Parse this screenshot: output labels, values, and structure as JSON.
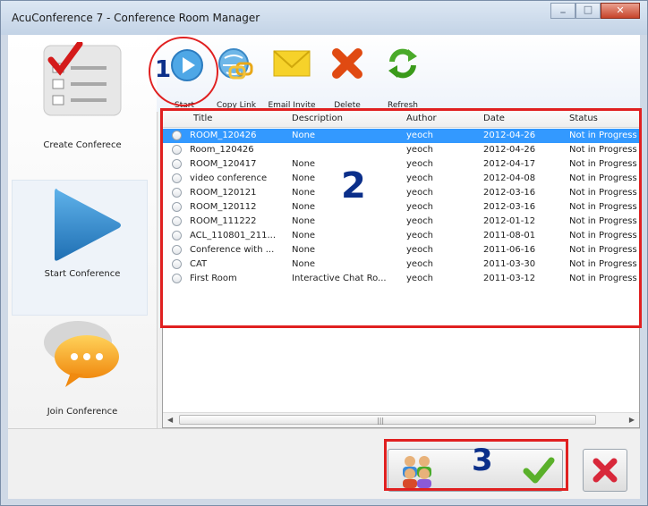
{
  "window": {
    "title": "AcuConference 7 - Conference Room Manager"
  },
  "sidebar": {
    "items": [
      {
        "label": "Create Conferece",
        "icon": "checklist-icon"
      },
      {
        "label": "Start Conference",
        "icon": "play-arrow-icon",
        "selected": true
      },
      {
        "label": "Join Conference",
        "icon": "chat-bubble-icon"
      }
    ]
  },
  "toolbar": {
    "start_label": "Start",
    "copy_label": "Copy Link",
    "email_label": "Email Invite",
    "delete_label": "Delete",
    "refresh_label": "Refresh"
  },
  "table": {
    "columns": [
      "Title",
      "Description",
      "Author",
      "Date",
      "Status"
    ],
    "rows": [
      {
        "title": "ROOM_120426",
        "description": "None",
        "author": "yeoch",
        "date": "2012-04-26",
        "status": "Not in Progress",
        "selected": true
      },
      {
        "title": "Room_120426",
        "description": "",
        "author": "yeoch",
        "date": "2012-04-26",
        "status": "Not in Progress"
      },
      {
        "title": "ROOM_120417",
        "description": "None",
        "author": "yeoch",
        "date": "2012-04-17",
        "status": "Not in Progress"
      },
      {
        "title": "video conference",
        "description": "None",
        "author": "yeoch",
        "date": "2012-04-08",
        "status": "Not in Progress"
      },
      {
        "title": "ROOM_120121",
        "description": "None",
        "author": "yeoch",
        "date": "2012-03-16",
        "status": "Not in Progress"
      },
      {
        "title": "ROOM_120112",
        "description": "None",
        "author": "yeoch",
        "date": "2012-03-16",
        "status": "Not in Progress"
      },
      {
        "title": "ROOM_111222",
        "description": "None",
        "author": "yeoch",
        "date": "2012-01-12",
        "status": "Not in Progress"
      },
      {
        "title": "ACL_110801_211...",
        "description": "None",
        "author": "yeoch",
        "date": "2011-08-01",
        "status": "Not in Progress"
      },
      {
        "title": "Conference with ...",
        "description": "None",
        "author": "yeoch",
        "date": "2011-06-16",
        "status": "Not in Progress"
      },
      {
        "title": "CAT",
        "description": "None",
        "author": "yeoch",
        "date": "2011-03-30",
        "status": "Not in Progress"
      },
      {
        "title": "First Room",
        "description": "Interactive Chat Ro...",
        "author": "yeoch",
        "date": "2011-03-12",
        "status": "Not in Progress"
      }
    ]
  },
  "annotations": {
    "one": "1",
    "two": "2",
    "three": "3"
  },
  "colors": {
    "annotation_red": "#e02020",
    "annotation_number": "#0b2f8a",
    "selection_blue": "#3399ff"
  }
}
